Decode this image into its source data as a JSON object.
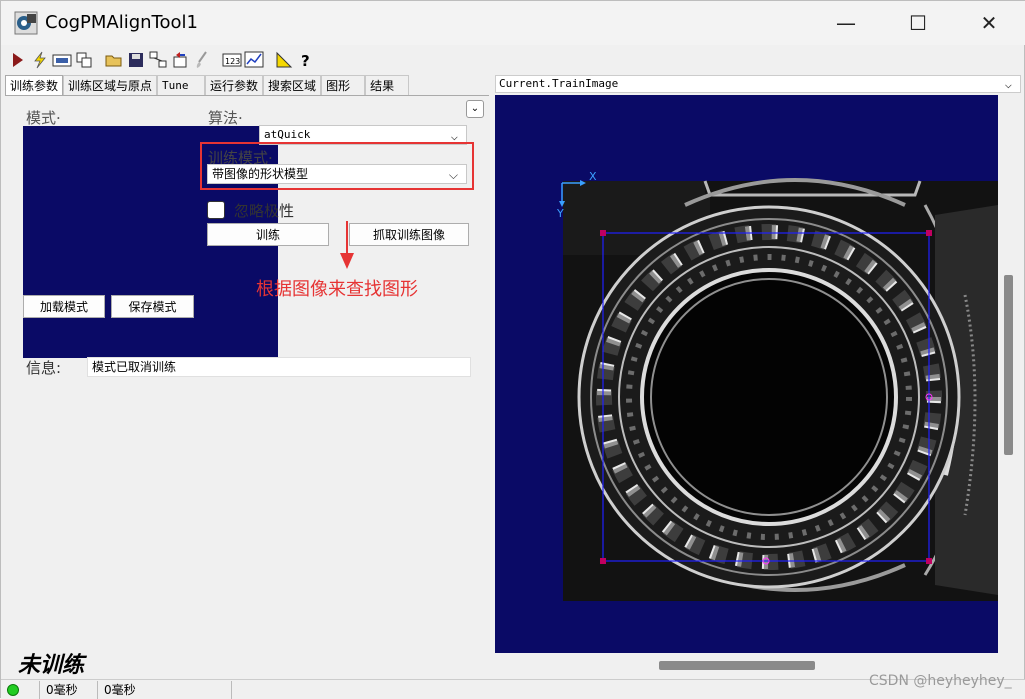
{
  "window": {
    "title": "CogPMAlignTool1",
    "minimize": "—",
    "maximize": "☐",
    "close": "✕"
  },
  "toolbar": {
    "icons": [
      "run-icon",
      "lightning-icon",
      "image-grab-icon",
      "copy-icon",
      "open-folder-icon",
      "save-icon",
      "network-icon",
      "reset-icon",
      "brush-icon",
      "numbers-icon",
      "graph-icon",
      "ruler-icon",
      "help-icon"
    ]
  },
  "tabs": [
    {
      "label": "训练参数"
    },
    {
      "label": "训练区域与原点"
    },
    {
      "label": "Tune"
    },
    {
      "label": "运行参数"
    },
    {
      "label": "搜索区域"
    },
    {
      "label": "图形"
    },
    {
      "label": "结果"
    }
  ],
  "train_params": {
    "pattern_label": "模式·",
    "algorithm_label": "算法·",
    "algorithm_value": "atQuick",
    "train_mode_label": "训练模式·",
    "train_mode_value": "带图像的形状模型",
    "ignore_polarity_label": "忽略极性",
    "train_button": "训练",
    "grab_train_image_button": "抓取训练图像",
    "load_pattern_button": "加载模式",
    "save_pattern_button": "保存模式",
    "info_label": "信息:",
    "info_value": "模式已取消训练",
    "status_text": "未训练"
  },
  "annotation": {
    "text": "根据图像来查找图形",
    "color": "#e63434"
  },
  "display": {
    "image_select_value": "Current.TrainImage",
    "axis_x": "X",
    "axis_y": "Y",
    "background_color": "#0a0a66",
    "roi_color": "#2020ff"
  },
  "statusbar": {
    "led_color": "#22cc22",
    "time1": "0毫秒",
    "time2": "0毫秒"
  },
  "watermark": "CSDN @heyheyhey_"
}
